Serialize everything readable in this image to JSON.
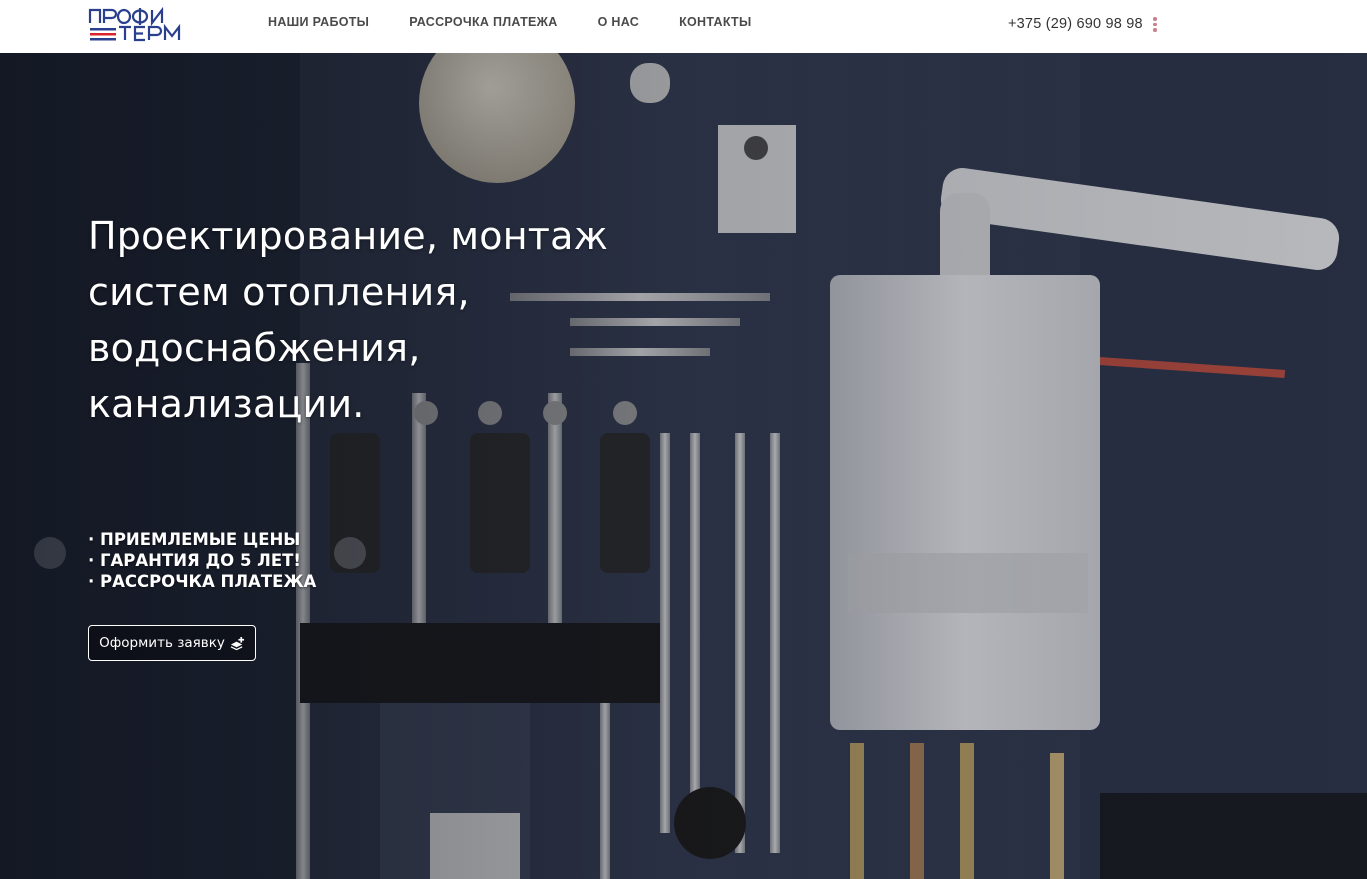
{
  "brand": {
    "logo_line1": "ПРОФИ",
    "logo_line2": "ТЕРМ",
    "logo_color": "#2b3f8f",
    "logo_accent": "#d8232a"
  },
  "nav": {
    "items": [
      {
        "label": "НАШИ РАБОТЫ"
      },
      {
        "label": "РАССРОЧКА ПЛАТЕЖА"
      },
      {
        "label": "О НАС"
      },
      {
        "label": "КОНТАКТЫ"
      }
    ]
  },
  "header": {
    "phone": "+375 (29) 690 98 98",
    "menu_icon": "kebab-menu-icon"
  },
  "hero": {
    "title_lines": [
      "Проектирование, монтаж",
      "систем отопления,",
      "водоснабжения,",
      "канализации."
    ],
    "features": [
      "· ПРИЕМЛЕМЫЕ ЦЕНЫ",
      "· ГАРАНТИЯ ДО 5 ЛЕТ!",
      "· РАССРОЧКА ПЛАТЕЖА"
    ],
    "cta_label": "Оформить заявку",
    "cta_icon": "stack-plus-icon",
    "background": "boiler-room-photo"
  }
}
